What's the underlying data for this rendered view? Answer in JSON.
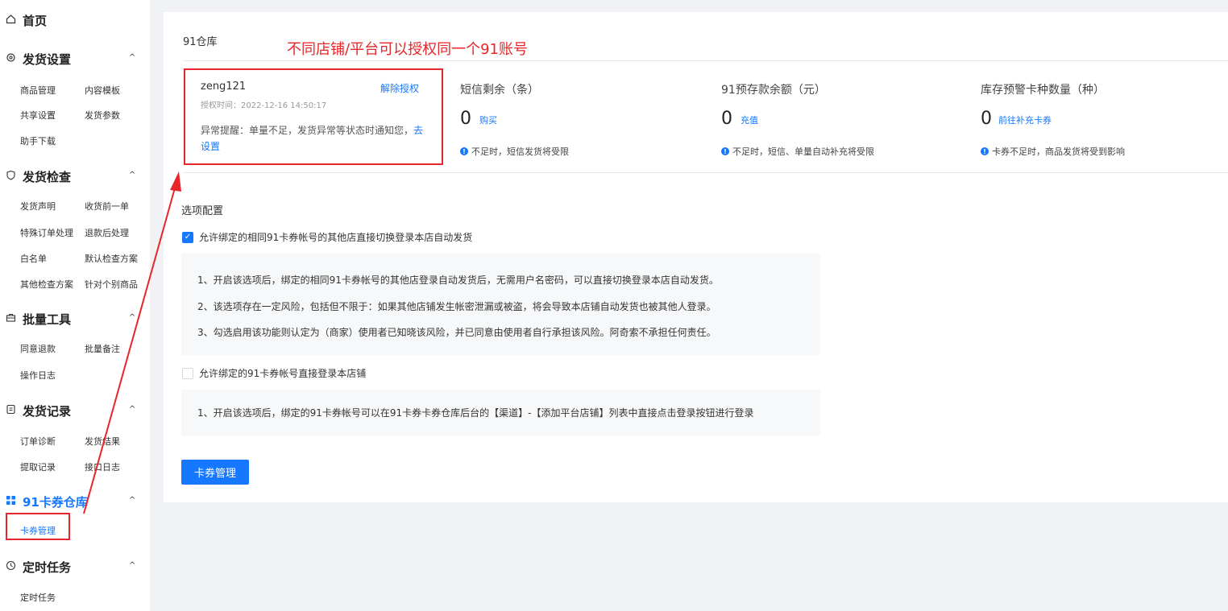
{
  "sidebar": {
    "home": "首页",
    "sections": [
      {
        "title": "发货设置",
        "items": [
          "商品管理",
          "内容模板",
          "共享设置",
          "发货参数",
          "助手下载"
        ]
      },
      {
        "title": "发货检查",
        "items": [
          "发货声明",
          "收货前一单",
          "特殊订单处理",
          "退款后处理",
          "白名单",
          "默认检查方案",
          "其他检查方案",
          "针对个别商品"
        ]
      },
      {
        "title": "批量工具",
        "items": [
          "同意退款",
          "批量备注",
          "操作日志"
        ]
      },
      {
        "title": "发货记录",
        "items": [
          "订单诊断",
          "发货结果",
          "提取记录",
          "接口日志"
        ]
      },
      {
        "title": "91卡券仓库",
        "items": [
          "卡券管理"
        ]
      },
      {
        "title": "定时任务",
        "items": [
          "定时任务"
        ]
      }
    ],
    "arrow": "^"
  },
  "main": {
    "title": "91仓库",
    "annotation": "不同店铺/平台可以授权同一个91账号",
    "account": {
      "name": "zeng121",
      "unbind": "解除授权",
      "time": "授权时间：2022-12-16 14:50:17",
      "notice": "异常提醒：单量不足，发货异常等状态时通知您，",
      "notice_link": "去设置"
    },
    "stats": [
      {
        "label": "短信剩余（条）",
        "value": "0",
        "link": "购买",
        "hint": "不足时，短信发货将受限"
      },
      {
        "label": "91预存款余额（元）",
        "value": "0",
        "link": "充值",
        "hint": "不足时，短信、单量自动补充将受限"
      },
      {
        "label": "库存预警卡种数量（种）",
        "value": "0",
        "link": "前往补充卡券",
        "hint": "卡券不足时，商品发货将受到影响"
      }
    ],
    "options_title": "选项配置",
    "option1": {
      "label": "允许绑定的相同91卡券帐号的其他店直接切换登录本店自动发货",
      "lines": [
        "1、开启该选项后，绑定的相同91卡券帐号的其他店登录自动发货后，无需用户名密码，可以直接切换登录本店自动发货。",
        "2、该选项存在一定风险，包括但不限于：如果其他店铺发生帐密泄漏或被盗，将会导致本店铺自动发货也被其他人登录。",
        "3、勾选启用该功能则认定为（商家）使用者已知晓该风险，并已同意由使用者自行承担该风险。阿奇索不承担任何责任。"
      ]
    },
    "option2": {
      "label": "允许绑定的91卡券帐号直接登录本店铺",
      "lines": [
        "1、开启该选项后，绑定的91卡券帐号可以在91卡券卡券仓库后台的【渠道】-【添加平台店铺】列表中直接点击登录按钮进行登录"
      ]
    },
    "button": "卡券管理"
  },
  "colors": {
    "accent": "#1677ff",
    "annotation": "#e8262a"
  }
}
